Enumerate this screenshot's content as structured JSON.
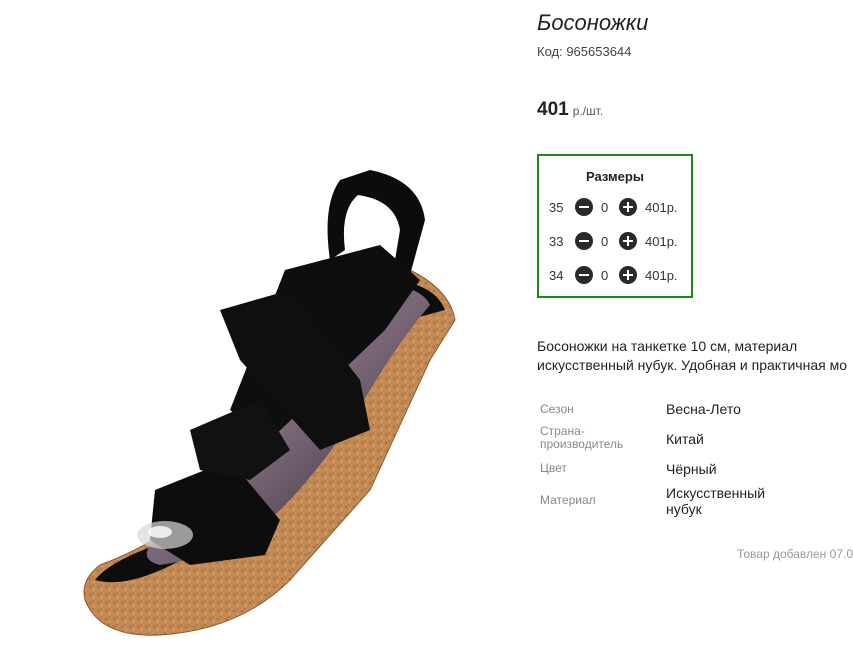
{
  "product": {
    "title": "Босоножки",
    "code": "Код: 965653644",
    "price": "401",
    "price_unit": "р./шт."
  },
  "sizes": {
    "title": "Размеры",
    "rows": [
      {
        "size": "35",
        "qty": "0",
        "price": "401р."
      },
      {
        "size": "33",
        "qty": "0",
        "price": "401р."
      },
      {
        "size": "34",
        "qty": "0",
        "price": "401р."
      }
    ]
  },
  "description": {
    "line1": "Босоножки на танкетке 10 см, материал",
    "line2": "искусственный нубук. Удобная и практичная мо"
  },
  "attributes": [
    {
      "name": "Сезон",
      "value": "Весна-Лето"
    },
    {
      "name": "Страна-\nпроизводитель",
      "value": "Китай"
    },
    {
      "name": "Цвет",
      "value": "Чёрный"
    },
    {
      "name": "Материал",
      "value": "Искусственный\nнубук"
    }
  ],
  "footer": {
    "added": "Товар добавлен 07.0"
  },
  "colors": {
    "sizes_border": "#1a8a1a",
    "button": "#2a2a2a",
    "wedge": "#c48a55",
    "strap": "#0c0c0c"
  }
}
